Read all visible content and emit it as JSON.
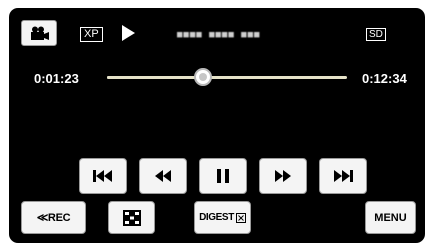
{
  "status_bar": {
    "quality": "XP",
    "file_name": "■■■■ ■■■■ ■■■",
    "media": "SD"
  },
  "playback": {
    "current_time": "0:01:23",
    "total_time": "0:12:34",
    "progress": 0.4
  },
  "controls": [
    {
      "name": "skip-previous-button",
      "icon": "skip-previous-icon"
    },
    {
      "name": "rewind-button",
      "icon": "rewind-icon"
    },
    {
      "name": "pause-button",
      "icon": "pause-icon"
    },
    {
      "name": "fast-forward-button",
      "icon": "fast-forward-icon"
    },
    {
      "name": "skip-next-button",
      "icon": "skip-next-icon"
    }
  ],
  "bottom_bar": {
    "rec_label": "≪REC",
    "digest_label": "DIGEST",
    "digest_icon": "checkbox-x-icon",
    "index_icon": "index-grid-icon",
    "menu_label": "MENU"
  },
  "colors": {
    "background": "#000000",
    "button": "#f4f4f4",
    "track": "#e6e3c9"
  }
}
